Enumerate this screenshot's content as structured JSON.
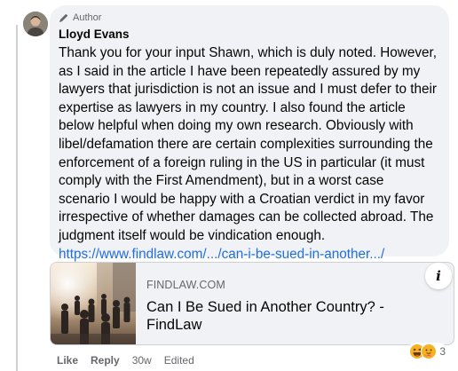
{
  "comment": {
    "badge": "Author",
    "author": "Lloyd Evans",
    "text": "Thank you for your input Shawn, which is duly noted. However, as I said in the article I have been repeatedly assured by my lawyers that jurisdiction is not an issue and I must defer to their expertise as lawyers in my country. I also found the article below helpful when doing my own research. Obviously with libel/defamation there are certain complexities surrounding the enforcement of a foreign ruling in the US in particular (it must comply with the First Amendment), but in a worst case scenario I would be happy with a Croatian verdict in my favor irrespective of whether damages can be collected abroad. The judgment itself would be vindication enough.",
    "link": "https://www.findlaw.com/.../can-i-be-sued-in-another.../"
  },
  "preview": {
    "domain": "FINDLAW.COM",
    "title": "Can I Be Sued in Another Country? - FindLaw",
    "info_icon": "i"
  },
  "actions": {
    "like": "Like",
    "reply": "Reply",
    "time": "30w",
    "edited": "Edited"
  },
  "reactions": {
    "icons": [
      "haha-icon",
      "care-icon"
    ],
    "count": "3"
  },
  "colors": {
    "bubble": "#f0f2f5",
    "link": "#216fdb",
    "muted": "#65676b"
  }
}
